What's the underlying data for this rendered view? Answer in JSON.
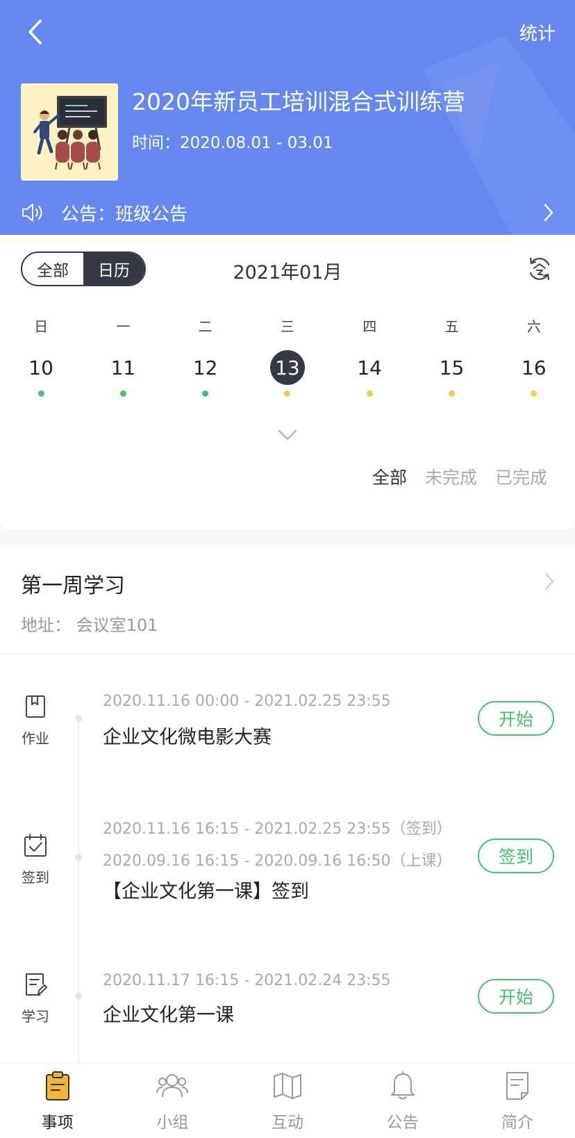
{
  "header": {
    "stats_label": "统计",
    "title": "2020年新员工培训混合式训练营",
    "time": "时间：2020.08.01 - 03.01",
    "notice": "公告：班级公告"
  },
  "calendar": {
    "view_tabs": [
      "全部",
      "日历"
    ],
    "active_view": "日历",
    "month": "2021年01月",
    "weekdays": [
      "日",
      "一",
      "二",
      "三",
      "四",
      "五",
      "六"
    ],
    "days": [
      {
        "num": "10",
        "dot_color": "#41c36b"
      },
      {
        "num": "11",
        "dot_color": "#41c36b"
      },
      {
        "num": "12",
        "dot_color": "#41c36b"
      },
      {
        "num": "13",
        "dot_color": "#f5c94d",
        "selected": true
      },
      {
        "num": "14",
        "dot_color": "#f5c94d"
      },
      {
        "num": "15",
        "dot_color": "#f5c94d"
      },
      {
        "num": "16",
        "dot_color": "#f5c94d"
      }
    ],
    "filters": [
      "全部",
      "未完成",
      "已完成"
    ],
    "active_filter": "全部"
  },
  "section": {
    "title": "第一周学习",
    "address": "地址：  会议室101"
  },
  "tasks": [
    {
      "type_label": "作业",
      "times": [
        "2020.11.16 00:00 - 2021.02.25 23:55"
      ],
      "name": "企业文化微电影大赛",
      "button": "开始"
    },
    {
      "type_label": "签到",
      "times": [
        "2020.11.16 16:15 - 2021.02.25 23:55（签到）",
        "2020.09.16 16:15 - 2020.09.16 16:50（上课）"
      ],
      "name": "【企业文化第一课】签到",
      "button": "签到"
    },
    {
      "type_label": "学习",
      "times": [
        "2020.11.17 16:15 - 2021.02.24 23:55"
      ],
      "name": "企业文化第一课",
      "button": "开始"
    }
  ],
  "tabbar": {
    "items": [
      "事项",
      "小组",
      "互动",
      "公告",
      "简介"
    ],
    "active": "事项"
  },
  "colors": {
    "header_bg": "#6488ef",
    "accent_green": "#41c36b",
    "pending_yellow": "#f5c94d",
    "dark": "#353945"
  }
}
